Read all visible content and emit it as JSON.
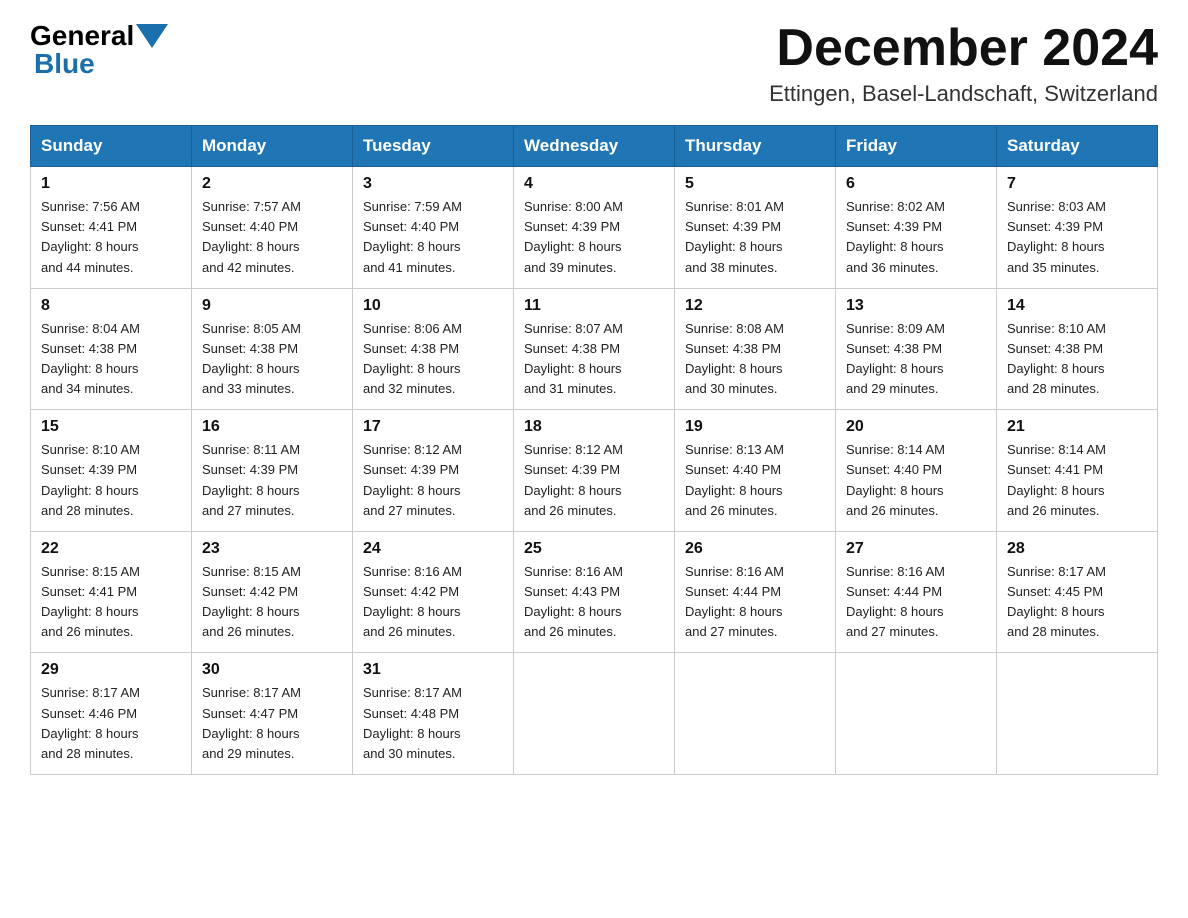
{
  "header": {
    "logo_general": "General",
    "logo_blue": "Blue",
    "month_title": "December 2024",
    "location": "Ettingen, Basel-Landschaft, Switzerland"
  },
  "weekdays": [
    "Sunday",
    "Monday",
    "Tuesday",
    "Wednesday",
    "Thursday",
    "Friday",
    "Saturday"
  ],
  "weeks": [
    [
      {
        "day": "1",
        "sunrise": "7:56 AM",
        "sunset": "4:41 PM",
        "daylight": "8 hours and 44 minutes."
      },
      {
        "day": "2",
        "sunrise": "7:57 AM",
        "sunset": "4:40 PM",
        "daylight": "8 hours and 42 minutes."
      },
      {
        "day": "3",
        "sunrise": "7:59 AM",
        "sunset": "4:40 PM",
        "daylight": "8 hours and 41 minutes."
      },
      {
        "day": "4",
        "sunrise": "8:00 AM",
        "sunset": "4:39 PM",
        "daylight": "8 hours and 39 minutes."
      },
      {
        "day": "5",
        "sunrise": "8:01 AM",
        "sunset": "4:39 PM",
        "daylight": "8 hours and 38 minutes."
      },
      {
        "day": "6",
        "sunrise": "8:02 AM",
        "sunset": "4:39 PM",
        "daylight": "8 hours and 36 minutes."
      },
      {
        "day": "7",
        "sunrise": "8:03 AM",
        "sunset": "4:39 PM",
        "daylight": "8 hours and 35 minutes."
      }
    ],
    [
      {
        "day": "8",
        "sunrise": "8:04 AM",
        "sunset": "4:38 PM",
        "daylight": "8 hours and 34 minutes."
      },
      {
        "day": "9",
        "sunrise": "8:05 AM",
        "sunset": "4:38 PM",
        "daylight": "8 hours and 33 minutes."
      },
      {
        "day": "10",
        "sunrise": "8:06 AM",
        "sunset": "4:38 PM",
        "daylight": "8 hours and 32 minutes."
      },
      {
        "day": "11",
        "sunrise": "8:07 AM",
        "sunset": "4:38 PM",
        "daylight": "8 hours and 31 minutes."
      },
      {
        "day": "12",
        "sunrise": "8:08 AM",
        "sunset": "4:38 PM",
        "daylight": "8 hours and 30 minutes."
      },
      {
        "day": "13",
        "sunrise": "8:09 AM",
        "sunset": "4:38 PM",
        "daylight": "8 hours and 29 minutes."
      },
      {
        "day": "14",
        "sunrise": "8:10 AM",
        "sunset": "4:38 PM",
        "daylight": "8 hours and 28 minutes."
      }
    ],
    [
      {
        "day": "15",
        "sunrise": "8:10 AM",
        "sunset": "4:39 PM",
        "daylight": "8 hours and 28 minutes."
      },
      {
        "day": "16",
        "sunrise": "8:11 AM",
        "sunset": "4:39 PM",
        "daylight": "8 hours and 27 minutes."
      },
      {
        "day": "17",
        "sunrise": "8:12 AM",
        "sunset": "4:39 PM",
        "daylight": "8 hours and 27 minutes."
      },
      {
        "day": "18",
        "sunrise": "8:12 AM",
        "sunset": "4:39 PM",
        "daylight": "8 hours and 26 minutes."
      },
      {
        "day": "19",
        "sunrise": "8:13 AM",
        "sunset": "4:40 PM",
        "daylight": "8 hours and 26 minutes."
      },
      {
        "day": "20",
        "sunrise": "8:14 AM",
        "sunset": "4:40 PM",
        "daylight": "8 hours and 26 minutes."
      },
      {
        "day": "21",
        "sunrise": "8:14 AM",
        "sunset": "4:41 PM",
        "daylight": "8 hours and 26 minutes."
      }
    ],
    [
      {
        "day": "22",
        "sunrise": "8:15 AM",
        "sunset": "4:41 PM",
        "daylight": "8 hours and 26 minutes."
      },
      {
        "day": "23",
        "sunrise": "8:15 AM",
        "sunset": "4:42 PM",
        "daylight": "8 hours and 26 minutes."
      },
      {
        "day": "24",
        "sunrise": "8:16 AM",
        "sunset": "4:42 PM",
        "daylight": "8 hours and 26 minutes."
      },
      {
        "day": "25",
        "sunrise": "8:16 AM",
        "sunset": "4:43 PM",
        "daylight": "8 hours and 26 minutes."
      },
      {
        "day": "26",
        "sunrise": "8:16 AM",
        "sunset": "4:44 PM",
        "daylight": "8 hours and 27 minutes."
      },
      {
        "day": "27",
        "sunrise": "8:16 AM",
        "sunset": "4:44 PM",
        "daylight": "8 hours and 27 minutes."
      },
      {
        "day": "28",
        "sunrise": "8:17 AM",
        "sunset": "4:45 PM",
        "daylight": "8 hours and 28 minutes."
      }
    ],
    [
      {
        "day": "29",
        "sunrise": "8:17 AM",
        "sunset": "4:46 PM",
        "daylight": "8 hours and 28 minutes."
      },
      {
        "day": "30",
        "sunrise": "8:17 AM",
        "sunset": "4:47 PM",
        "daylight": "8 hours and 29 minutes."
      },
      {
        "day": "31",
        "sunrise": "8:17 AM",
        "sunset": "4:48 PM",
        "daylight": "8 hours and 30 minutes."
      },
      null,
      null,
      null,
      null
    ]
  ]
}
